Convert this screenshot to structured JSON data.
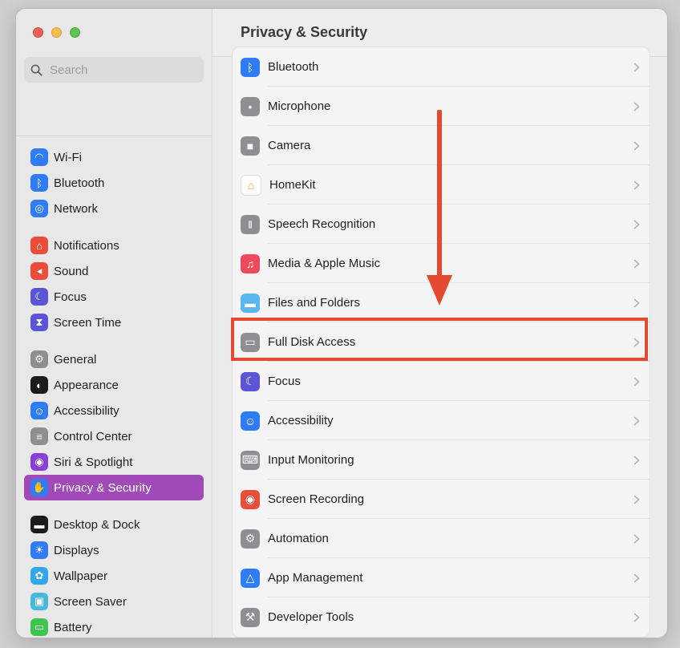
{
  "window": {
    "title": "Privacy & Security"
  },
  "search": {
    "placeholder": "Search"
  },
  "sidebar": {
    "groups": [
      [
        {
          "label": "Wi-Fi",
          "icon": "wifi-icon",
          "color": "#2f7cf6"
        },
        {
          "label": "Bluetooth",
          "icon": "bluetooth-icon",
          "color": "#2f7cf6"
        },
        {
          "label": "Network",
          "icon": "globe-icon",
          "color": "#2f7cf6"
        }
      ],
      [
        {
          "label": "Notifications",
          "icon": "bell-icon",
          "color": "#eb4d3d"
        },
        {
          "label": "Sound",
          "icon": "speaker-icon",
          "color": "#eb4d3d"
        },
        {
          "label": "Focus",
          "icon": "moon-icon",
          "color": "#5b55d6"
        },
        {
          "label": "Screen Time",
          "icon": "hourglass-icon",
          "color": "#5b55d6"
        }
      ],
      [
        {
          "label": "General",
          "icon": "gear-icon",
          "color": "#8e8e93"
        },
        {
          "label": "Appearance",
          "icon": "appearance-icon",
          "color": "#1c1c1e"
        },
        {
          "label": "Accessibility",
          "icon": "accessibility-icon",
          "color": "#2f7cf6"
        },
        {
          "label": "Control Center",
          "icon": "toggles-icon",
          "color": "#8e8e93"
        },
        {
          "label": "Siri & Spotlight",
          "icon": "siri-icon",
          "color": "#8a3fd6"
        },
        {
          "label": "Privacy & Security",
          "icon": "hand-icon",
          "color": "#2f7cf6",
          "selected": true
        }
      ],
      [
        {
          "label": "Desktop & Dock",
          "icon": "dock-icon",
          "color": "#1c1c1e"
        },
        {
          "label": "Displays",
          "icon": "sun-icon",
          "color": "#2f7cf6"
        },
        {
          "label": "Wallpaper",
          "icon": "flower-icon",
          "color": "#35a7e8"
        },
        {
          "label": "Screen Saver",
          "icon": "screensaver-icon",
          "color": "#49b8d8"
        },
        {
          "label": "Battery",
          "icon": "battery-icon",
          "color": "#3fc44f"
        }
      ]
    ]
  },
  "main": {
    "rows": [
      {
        "label": "Bluetooth",
        "icon": "bluetooth-icon",
        "color": "#2f7cf6"
      },
      {
        "label": "Microphone",
        "icon": "microphone-icon",
        "color": "#8e8e93"
      },
      {
        "label": "Camera",
        "icon": "camera-icon",
        "color": "#8e8e93"
      },
      {
        "label": "HomeKit",
        "icon": "home-icon",
        "color": "#ffffff"
      },
      {
        "label": "Speech Recognition",
        "icon": "waveform-icon",
        "color": "#8e8e93"
      },
      {
        "label": "Media & Apple Music",
        "icon": "music-note-icon",
        "color": "#f2485c"
      },
      {
        "label": "Files and Folders",
        "icon": "folder-icon",
        "color": "#5ab7f0"
      },
      {
        "label": "Full Disk Access",
        "icon": "disk-icon",
        "color": "#8e8e93",
        "highlighted": true
      },
      {
        "label": "Focus",
        "icon": "moon-icon",
        "color": "#5b55d6"
      },
      {
        "label": "Accessibility",
        "icon": "accessibility-icon",
        "color": "#2f7cf6"
      },
      {
        "label": "Input Monitoring",
        "icon": "keyboard-icon",
        "color": "#8e8e93"
      },
      {
        "label": "Screen Recording",
        "icon": "record-icon",
        "color": "#eb4d3d"
      },
      {
        "label": "Automation",
        "icon": "gears-icon",
        "color": "#8e8e93"
      },
      {
        "label": "App Management",
        "icon": "app-store-icon",
        "color": "#2f7cf6"
      },
      {
        "label": "Developer Tools",
        "icon": "hammer-icon",
        "color": "#8e8e93"
      }
    ]
  },
  "annotation": {
    "color": "#e5492f"
  }
}
